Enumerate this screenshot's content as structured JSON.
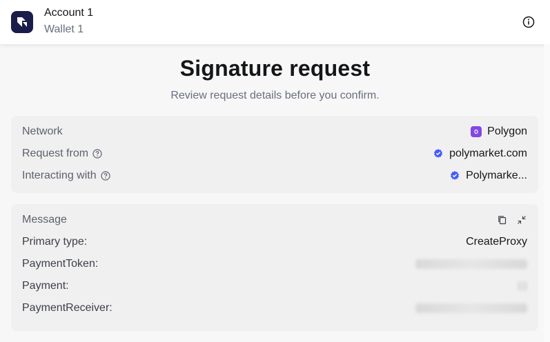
{
  "header": {
    "account_name": "Account 1",
    "wallet_name": "Wallet 1"
  },
  "title": "Signature request",
  "subtitle": "Review request details before you confirm.",
  "details": {
    "network_label": "Network",
    "network_value": "Polygon",
    "request_from_label": "Request from",
    "request_from_value": "polymarket.com",
    "interacting_label": "Interacting with",
    "interacting_value": "Polymarke..."
  },
  "message": {
    "label": "Message",
    "primary_type_label": "Primary type:",
    "primary_type_value": "CreateProxy",
    "payment_token_label": "PaymentToken:",
    "payment_label": "Payment:",
    "payment_receiver_label": "PaymentReceiver:"
  },
  "colors": {
    "polygon": "#8247e5",
    "verified": "#4459ff",
    "logo_bg": "#1a1c49"
  },
  "icons": {
    "info": "info-icon",
    "question": "question-icon",
    "copy": "copy-icon",
    "collapse": "collapse-icon",
    "verified": "verified-icon"
  }
}
